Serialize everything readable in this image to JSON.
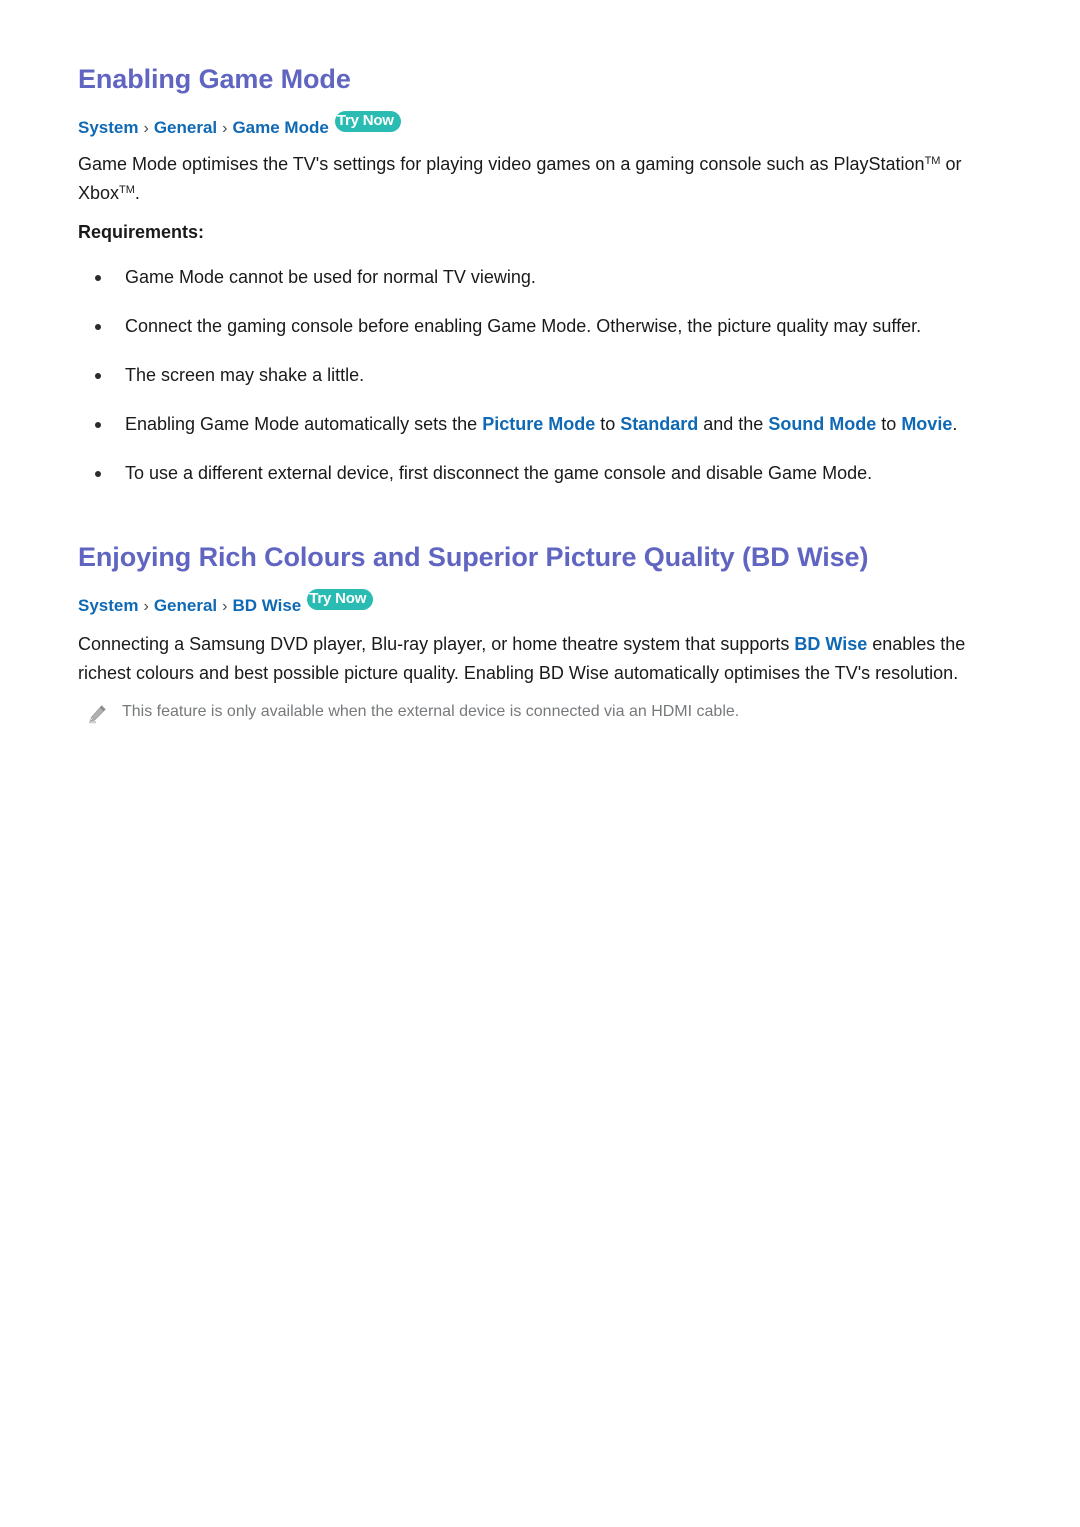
{
  "colors": {
    "heading": "#6065c2",
    "link_blue": "#0f69b4",
    "try_now_bg": "#2abcb2",
    "body": "#1a1a1a",
    "note_gray": "#76797c"
  },
  "sections": [
    {
      "title": "Enabling Game Mode",
      "breadcrumb": {
        "crumb1": "System",
        "sep1": "›",
        "crumb2": "General",
        "sep2": "›",
        "crumb3": "Game Mode",
        "try_now": "Try Now"
      },
      "intro_part1": "Game Mode optimises the TV's settings for playing video games on a gaming console such as PlayStation",
      "intro_tm1": "TM",
      "intro_part2": " or Xbox",
      "intro_tm2": "TM",
      "intro_part3": ".",
      "requirements_label": "Requirements:",
      "bullets": [
        {
          "text": "Game Mode cannot be used for normal TV viewing."
        },
        {
          "text": "Connect the gaming console before enabling Game Mode. Otherwise, the picture quality may suffer."
        },
        {
          "text": "The screen may shake a little."
        },
        {
          "prefix": "Enabling Game Mode automatically sets the ",
          "kw1": "Picture Mode",
          "mid1": " to ",
          "kw2": "Standard",
          "mid2": " and the ",
          "kw3": "Sound Mode",
          "mid3": " to ",
          "kw4": "Movie",
          "suffix": "."
        },
        {
          "text": "To use a different external device, first disconnect the game console and disable Game Mode."
        }
      ]
    },
    {
      "title": "Enjoying Rich Colours and Superior Picture Quality (BD Wise)",
      "breadcrumb": {
        "crumb1": "System",
        "sep1": "›",
        "crumb2": "General",
        "sep2": "›",
        "crumb3": "BD Wise",
        "try_now": "Try Now"
      },
      "paragraph_part1": "Connecting a Samsung DVD player, Blu-ray player, or home theatre system that supports ",
      "paragraph_kw": "BD Wise",
      "paragraph_part2": " enables the richest colours and best possible picture quality. Enabling BD Wise automatically optimises the TV's resolution.",
      "note": {
        "icon": "pencil-icon",
        "text": "This feature is only available when the external device is connected via an HDMI cable."
      }
    }
  ]
}
